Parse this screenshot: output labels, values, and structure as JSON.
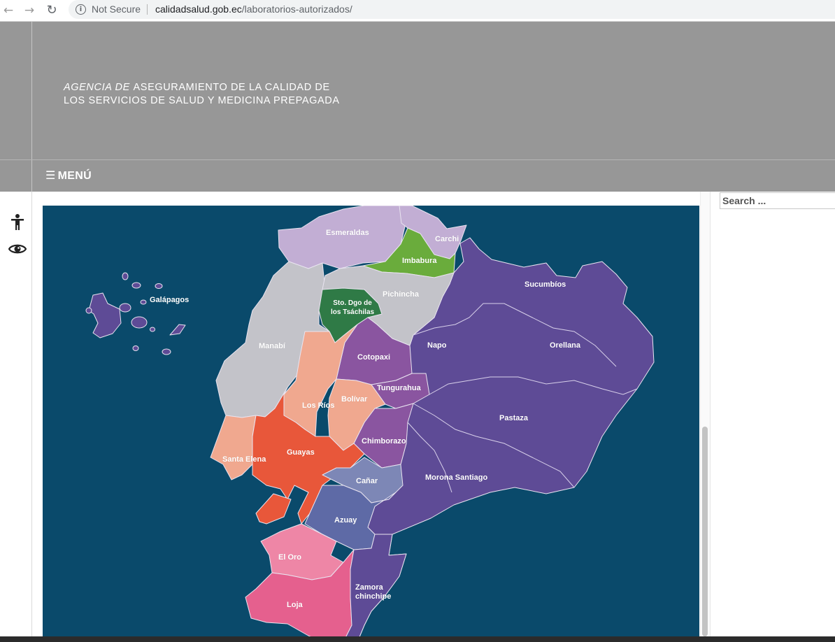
{
  "browser": {
    "back_icon": "←",
    "forward_icon": "→",
    "reload_icon": "↻",
    "info_icon": "i",
    "security_label": "Not Secure",
    "url_domain": "calidadsalud.gob.ec",
    "url_path": "/laboratorios-autorizados/"
  },
  "header": {
    "logo_line1_thin": "AGENCIA DE ",
    "logo_line1_bold": "ASEGURAMIENTO DE LA CALIDAD DE",
    "logo_line2": "LOS SERVICIOS DE SALUD Y MEDICINA PREPAGADA",
    "menu_icon": "☰",
    "menu_label": "MENÚ"
  },
  "accessibility": {
    "icons": [
      "accessibility-person-icon",
      "eye-icon"
    ]
  },
  "sidebar": {
    "search_placeholder": "Search ..."
  },
  "map": {
    "colors": {
      "background": "#0a4a6b",
      "sierra_light": "#c3c3c9",
      "esmeraldas": "#c2aed4",
      "imbabura": "#6aac3c",
      "sto_domingo": "#2f7a46",
      "amazon": "#5e4b96",
      "guayas": "#e8573a",
      "peach": "#f0a88f",
      "cotopaxi": "#8a55a0",
      "canar": "#7d87b6",
      "azuay": "#5e6aa6",
      "el_oro": "#ee86a6",
      "loja": "#e5608e"
    },
    "regions": {
      "galapagos": "Galápagos",
      "esmeraldas": "Esmeraldas",
      "carchi": "Carchi",
      "imbabura": "Imbabura",
      "sucumbios": "Sucumbíos",
      "pichincha": "Pichincha",
      "sto_dgo_line1": "Sto. Dgo de",
      "sto_dgo_line2": "los Tsáchilas",
      "manabi": "Manabí",
      "napo": "Napo",
      "orellana": "Orellana",
      "cotopaxi": "Cotopaxi",
      "tungurahua": "Tungurahua",
      "los_rios": "Los Ríos",
      "bolivar": "Bolívar",
      "pastaza": "Pastaza",
      "chimborazo": "Chimborazo",
      "santa_elena": "Santa Elena",
      "guayas": "Guayas",
      "canar": "Cañar",
      "morona": "Morona Santiago",
      "azuay": "Azuay",
      "el_oro": "El Oro",
      "zamora_line1": "Zamora",
      "zamora_line2": "chinchipe",
      "loja": "Loja"
    }
  }
}
